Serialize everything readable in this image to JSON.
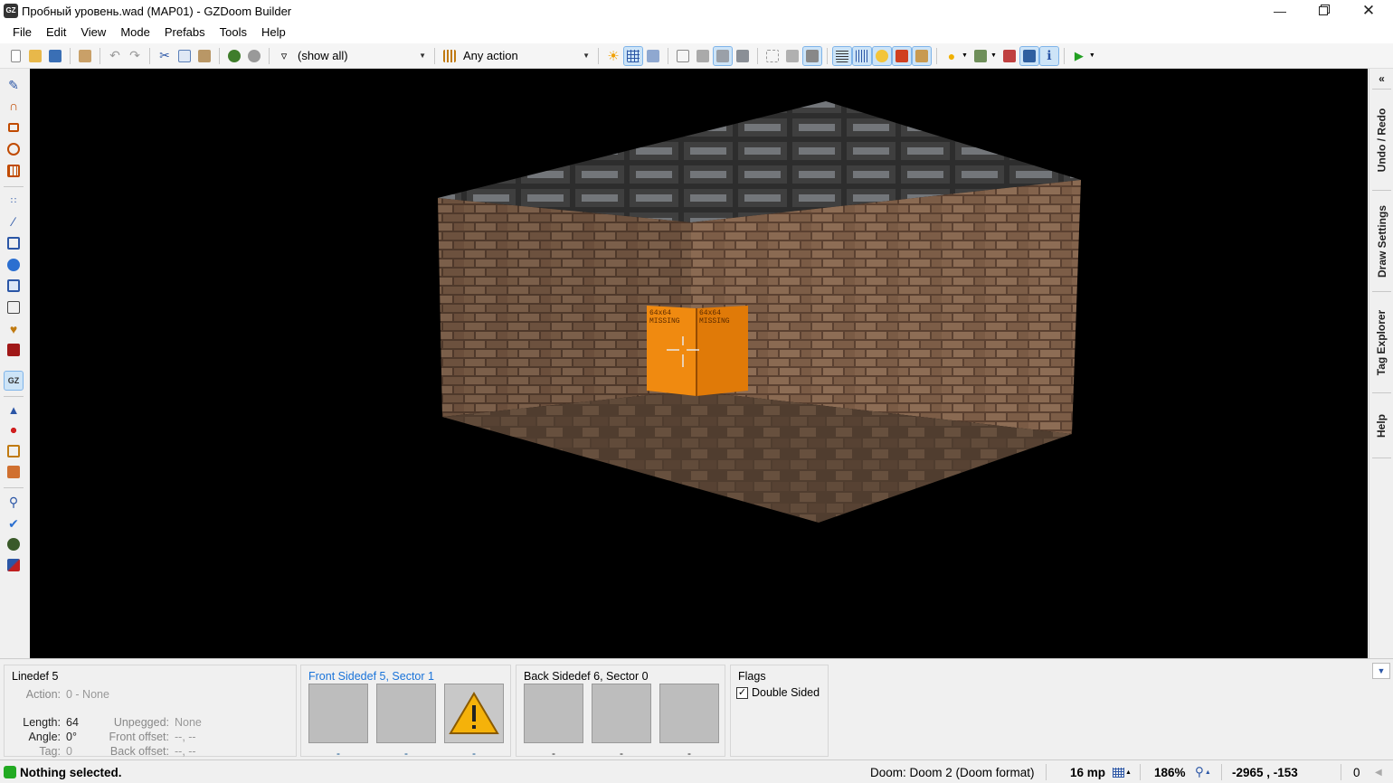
{
  "window": {
    "title": "Пробный уровень.wad (MAP01) - GZDoom Builder",
    "app_icon_text": "GZ"
  },
  "menu": [
    "File",
    "Edit",
    "View",
    "Mode",
    "Prefabs",
    "Tools",
    "Help"
  ],
  "toolbar": {
    "filter_value": "(show all)",
    "action_value": "Any action"
  },
  "viewport": {
    "box_label_1": "64x64\nMISSING",
    "box_label_2": "64x64\nMISSING"
  },
  "dock_tabs": [
    "Undo / Redo",
    "Draw Settings",
    "Tag Explorer",
    "Help"
  ],
  "linedef": {
    "title": "Linedef 5",
    "action_label": "Action:",
    "action_value": "0 - None",
    "length_label": "Length:",
    "length_value": "64",
    "angle_label": "Angle:",
    "angle_value": "0°",
    "tag_label": "Tag:",
    "tag_value": "0",
    "unpegged_label": "Unpegged:",
    "unpegged_value": "None",
    "front_offset_label": "Front offset:",
    "front_offset_value": "--, --",
    "back_offset_label": "Back offset:",
    "back_offset_value": "--, --"
  },
  "front_sidedef": {
    "title": "Front Sidedef 5, Sector 1",
    "captions": [
      "-",
      "-",
      "-"
    ]
  },
  "back_sidedef": {
    "title": "Back Sidedef 6, Sector 0",
    "captions": [
      "-",
      "-",
      "-"
    ]
  },
  "flags": {
    "title": "Flags",
    "double_sided_label": "Double Sided",
    "double_sided_checked": true
  },
  "status": {
    "message": "Nothing selected.",
    "game": "Doom: Doom 2 (Doom format)",
    "grid": "16 mp",
    "zoom": "186%",
    "coords": "-2965 , -153",
    "count": "0"
  },
  "colors": {
    "accent": "#1a73d9",
    "status_ok": "#22aa22",
    "brick": "#7a5a44",
    "box": "#f08a10"
  }
}
